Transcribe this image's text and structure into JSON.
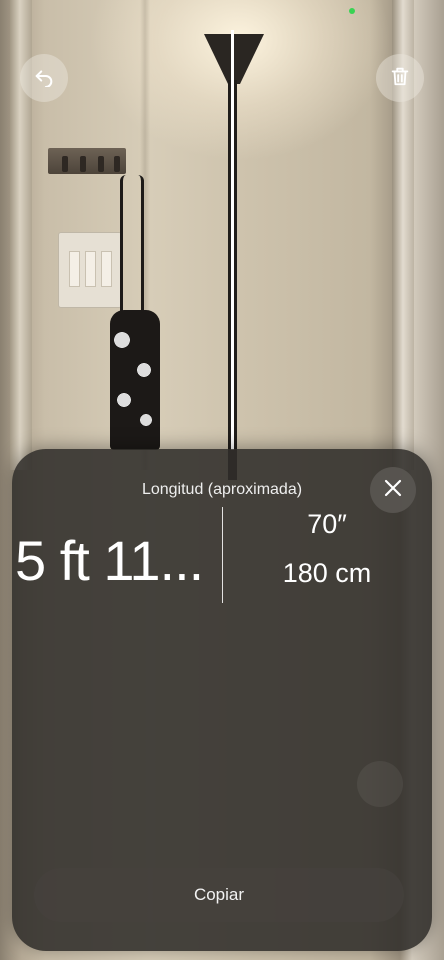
{
  "measurement_sheet": {
    "title": "Longitud (aproximada)",
    "primary_value": "5 ft 11...",
    "secondary_inches": "70″",
    "secondary_cm": "180 cm",
    "copy_label": "Copiar"
  },
  "icons": {
    "close": "close-icon",
    "undo": "undo-icon",
    "trash": "trash-icon"
  },
  "colors": {
    "sheet_bg": "#302d2a",
    "measure_line": "#ffffff",
    "tracking_dot": "#39d353"
  }
}
